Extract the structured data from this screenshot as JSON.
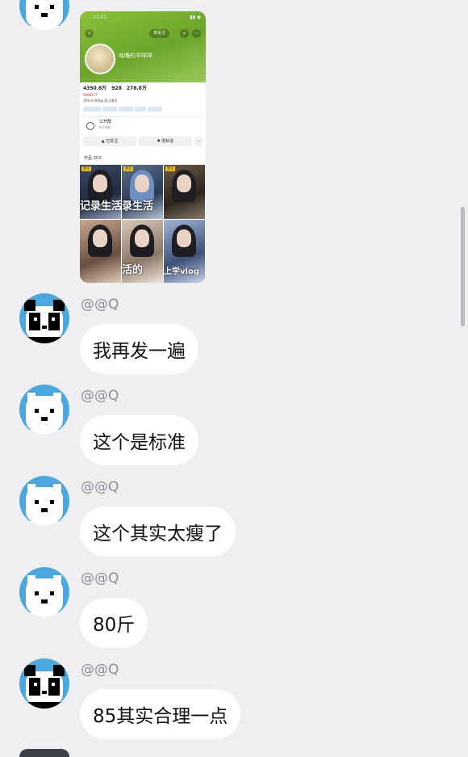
{
  "shared_screenshot": {
    "status_time": "11:01",
    "follow_label": "未关注",
    "profile_name": "咕噜的羊咩咩",
    "stats": [
      "4350.8万",
      "928",
      "278.8万"
    ],
    "bio_handle": "9889477",
    "bio_line": "165cm 80kg 双上限还",
    "public_label": "公开群",
    "public_sub": "有1群聊",
    "followed_button": "已关注",
    "message_button": "发私信",
    "works_label": "作品 303",
    "thumbnails": [
      {
        "badge": "置顶",
        "overlay": "记录生活"
      },
      {
        "badge": "置顶",
        "overlay": "录生活"
      },
      {
        "badge": "置顶",
        "overlay": ""
      },
      {
        "badge": "",
        "overlay": ""
      },
      {
        "badge": "",
        "overlay": "活的"
      },
      {
        "badge": "",
        "overlay": "上学vlog"
      }
    ]
  },
  "messages": [
    {
      "sender": "@@Q",
      "text": "我再发一遍",
      "avatar": "panda-crying"
    },
    {
      "sender": "@@Q",
      "text": "这个是标准",
      "avatar": "polar-bear"
    },
    {
      "sender": "@@Q",
      "text": "这个其实太瘦了",
      "avatar": "polar-bear"
    },
    {
      "sender": "@@Q",
      "text": "80斤",
      "avatar": "polar-bear"
    },
    {
      "sender": "@@Q",
      "text": "85其实合理一点",
      "avatar": "panda-crying"
    }
  ],
  "colors": {
    "background": "#efeff1",
    "avatar_bg": "#4aa8de",
    "bubble": "#ffffff",
    "sender": "#8d8d93"
  }
}
